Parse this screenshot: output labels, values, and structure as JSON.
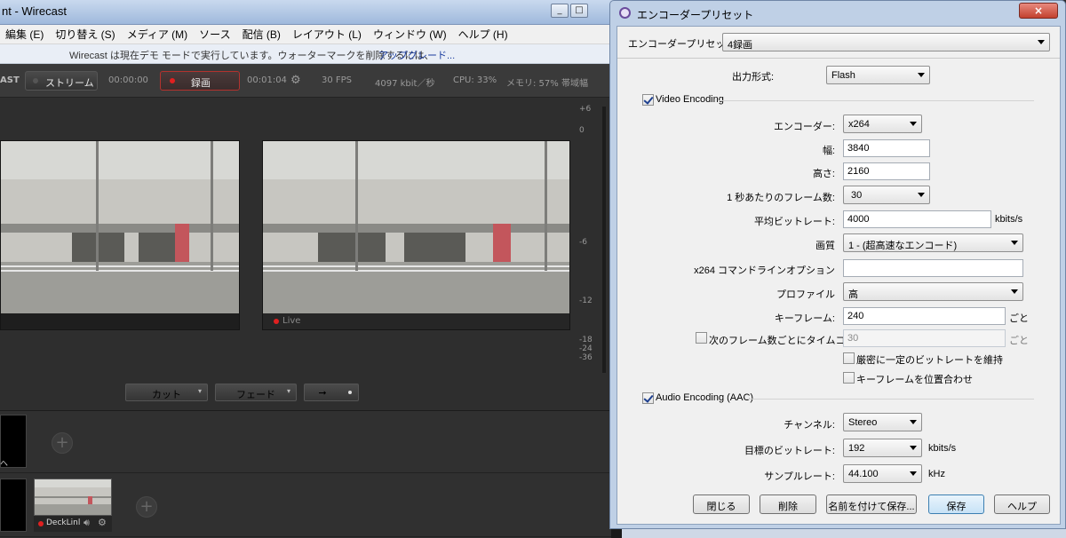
{
  "wirecast": {
    "title": "nt - Wirecast",
    "win_buttons": [
      "_",
      "□",
      "×"
    ],
    "menu": [
      "編集 (E)",
      "切り替え (S)",
      "メディア (M)",
      "ソース",
      "配信 (B)",
      "レイアウト (L)",
      "ウィンドウ (W)",
      "ヘルプ (H)"
    ],
    "demo_message": "Wirecast は現在デモ モードで実行しています。ウォーターマークを削除するには、",
    "upgrade_link": "アップグレード...",
    "toolbar": {
      "brand": "AST",
      "stream_label": "ストリーム",
      "stream_time": "00:00:00",
      "record_label": "録画",
      "record_time": "00:01:04",
      "fps": "30 FPS",
      "bitrate": "4097 kbit／秒",
      "cpu": "CPU: 33%",
      "memory": "メモリ: 57%",
      "bandwidth": "帯域幅"
    },
    "live_label": "Live",
    "meter_ticks": [
      "+6",
      "0",
      "-6",
      "-12",
      "-18",
      "-24",
      "-36"
    ],
    "transitions": {
      "cut": "カット",
      "fade": "フェード",
      "go": "➞"
    },
    "layer_source_label": "DeckLinl",
    "layer_cut_label": "ヘ"
  },
  "dialog": {
    "title": "エンコーダープリセット",
    "close_glyph": "×",
    "preset_label": "エンコーダープリセット:",
    "preset_value": "4録画",
    "output_format_label": "出力形式:",
    "output_format_value": "Flash",
    "video_section": "Video Encoding",
    "video_checked": true,
    "encoder_label": "エンコーダー:",
    "encoder_value": "x264",
    "width_label": "幅:",
    "width_value": "3840",
    "height_label": "高さ:",
    "height_value": "2160",
    "fps_label": "1 秒あたりのフレーム数:",
    "fps_value": "30",
    "avg_bitrate_label": "平均ビットレート:",
    "avg_bitrate_value": "4000",
    "avg_bitrate_unit": "kbits/s",
    "quality_label": "画質",
    "quality_value": "1 - (超高速なエンコード)",
    "cmdline_label": "x264 コマンドラインオプション",
    "cmdline_value": "",
    "profile_label": "プロファイル",
    "profile_value": "高",
    "keyframe_label": "キーフレーム:",
    "keyframe_value": "240",
    "keyframe_unit": "ごと",
    "timecode_label": "次のフレーム数ごとにタイムコード:",
    "timecode_value": "30",
    "timecode_unit": "ごと",
    "timecode_checked": false,
    "strict_cbr_label": "厳密に一定のビットレートを維持",
    "strict_cbr_checked": false,
    "align_keyframes_label": "キーフレームを位置合わせ",
    "align_keyframes_checked": false,
    "audio_section": "Audio Encoding (AAC)",
    "audio_checked": true,
    "channel_label": "チャンネル:",
    "channel_value": "Stereo",
    "target_bitrate_label": "目標のビットレート:",
    "target_bitrate_value": "192",
    "target_bitrate_unit": "kbits/s",
    "sample_rate_label": "サンプルレート:",
    "sample_rate_value": "44.100",
    "sample_rate_unit": "kHz",
    "buttons": {
      "close": "閉じる",
      "delete": "削除",
      "save_as": "名前を付けて保存...",
      "save": "保存",
      "help": "ヘルプ"
    }
  },
  "colors": {
    "record_red": "#e02020",
    "dialog_frame": "#bfd0e6",
    "dark_ui": "#2e2e2e"
  }
}
